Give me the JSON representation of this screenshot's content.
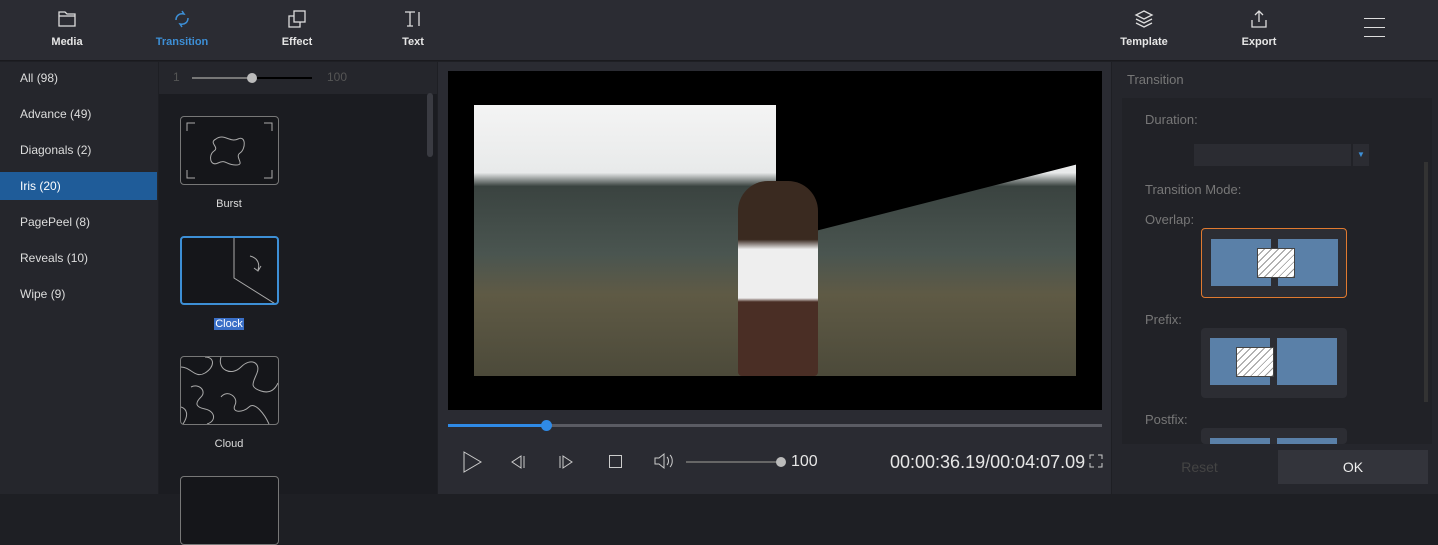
{
  "toolbar": {
    "media": "Media",
    "transition": "Transition",
    "effect": "Effect",
    "text": "Text",
    "template": "Template",
    "export": "Export"
  },
  "categories": [
    {
      "label": "All",
      "count": "(98)"
    },
    {
      "label": "Advance",
      "count": "(49)"
    },
    {
      "label": "Diagonals",
      "count": "(2)"
    },
    {
      "label": "Iris",
      "count": "(20)"
    },
    {
      "label": "PagePeel",
      "count": "(8)"
    },
    {
      "label": "Reveals",
      "count": "(10)"
    },
    {
      "label": "Wipe",
      "count": "(9)"
    }
  ],
  "list_slider": {
    "min": "1",
    "max": "100",
    "value_percent": 50
  },
  "transitions": [
    {
      "label": "Burst"
    },
    {
      "label": "Clock"
    },
    {
      "label": "Cloud"
    }
  ],
  "player": {
    "progress_percent": 15,
    "volume": "100",
    "time": "00:00:36.19/00:04:07.09"
  },
  "panel": {
    "title": "Transition",
    "duration_label": "Duration:",
    "duration_value": "",
    "mode_label": "Transition Mode:",
    "overlap": "Overlap:",
    "prefix": "Prefix:",
    "postfix": "Postfix:",
    "reset": "Reset",
    "ok": "OK"
  },
  "colors": {
    "accent": "#3d8fd6",
    "selected_border": "#e07a30"
  }
}
